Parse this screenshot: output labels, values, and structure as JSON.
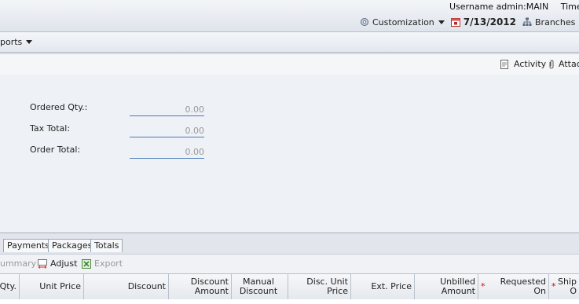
{
  "header": {
    "username": "Username admin:MAIN",
    "timezone": "Time Zon",
    "customization": "Customization",
    "date": "7/13/2012",
    "branches": "Branches"
  },
  "menu": {
    "reports": "ports"
  },
  "actions": {
    "activity": "Activity",
    "attach": "Attac"
  },
  "form": {
    "ordered_qty_label": "Ordered Qty.:",
    "ordered_qty_value": "0.00",
    "tax_total_label": "Tax Total:",
    "tax_total_value": "0.00",
    "order_total_label": "Order Total:",
    "order_total_value": "0.00"
  },
  "tabs": [
    "Payments",
    "Packages",
    "Totals"
  ],
  "grid_toolbar": {
    "summary": "ummary",
    "adjust": "Adjust",
    "export": "Export"
  },
  "columns": [
    {
      "label": "Qty.",
      "required": false
    },
    {
      "label": "Unit Price",
      "required": false
    },
    {
      "label": "Discount",
      "required": false
    },
    {
      "label": "Discount Amount",
      "required": false
    },
    {
      "label": "Manual Discount",
      "required": false
    },
    {
      "label": "Disc. Unit Price",
      "required": false
    },
    {
      "label": "Ext. Price",
      "required": false
    },
    {
      "label": "Unbilled Amount",
      "required": false
    },
    {
      "label": "Requested On",
      "required": true
    },
    {
      "label": "Ship O",
      "required": true
    }
  ],
  "colors": {
    "field_underline": "#4a7ab8",
    "required_mark": "#dd0000"
  },
  "icons": [
    "gear-icon",
    "calendar-icon",
    "branches-icon",
    "document-icon",
    "paperclip-icon",
    "adjust-icon",
    "excel-icon"
  ]
}
